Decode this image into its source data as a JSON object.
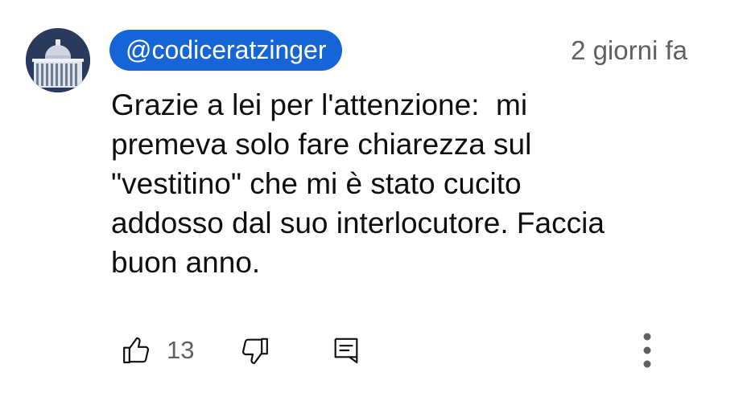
{
  "comment": {
    "author": "@codiceratzinger",
    "timestamp": "2 giorni fa",
    "text": "Grazie a lei per l'attenzione:  mi\npremeva solo fare chiarezza sul\n\"vestitino\" che mi è stato cucito\naddosso dal suo interlocutore. Faccia\nbuon anno.",
    "likes": "13"
  },
  "colors": {
    "author_badge": "#1565d8",
    "text": "#0f0f0f",
    "secondary_text": "#606060"
  },
  "icons": {
    "like": "thumbs-up-icon",
    "dislike": "thumbs-down-icon",
    "reply": "reply-icon",
    "more": "more-vertical-icon"
  }
}
